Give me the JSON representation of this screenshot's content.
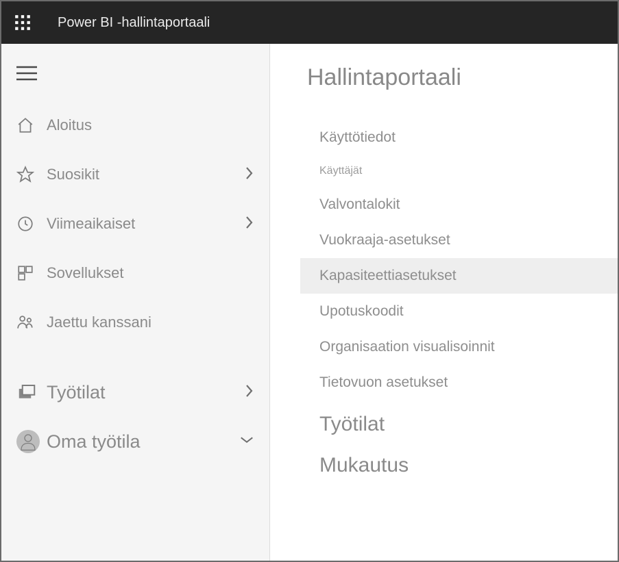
{
  "header": {
    "app_title": "Power BI -hallintaportaali"
  },
  "sidebar": {
    "items": [
      {
        "label": "Aloitus",
        "has_chevron": false
      },
      {
        "label": "Suosikit",
        "has_chevron": true
      },
      {
        "label": "Viimeaikaiset",
        "has_chevron": true
      },
      {
        "label": "Sovellukset",
        "has_chevron": false
      },
      {
        "label": "Jaettu kanssani",
        "has_chevron": false
      }
    ],
    "group": [
      {
        "label": "Työtilat",
        "chevron": "right"
      },
      {
        "label": "Oma työtila",
        "chevron": "down"
      }
    ]
  },
  "main": {
    "title": "Hallintaportaali",
    "menu": [
      {
        "label": "Käyttötiedot",
        "style": "normal"
      },
      {
        "label": "Käyttäjät",
        "style": "small"
      },
      {
        "label": "Valvontalokit",
        "style": "normal"
      },
      {
        "label": "Vuokraaja-asetukset",
        "style": "normal"
      },
      {
        "label": "Kapasiteettiasetukset",
        "style": "normal",
        "selected": true
      },
      {
        "label": "Upotuskoodit",
        "style": "normal"
      },
      {
        "label": "Organisaation visualisoinnit",
        "style": "normal"
      },
      {
        "label": "Tietovuon asetukset",
        "style": "normal"
      },
      {
        "label": "Työtilat",
        "style": "big"
      },
      {
        "label": "Mukautus",
        "style": "big"
      }
    ]
  }
}
